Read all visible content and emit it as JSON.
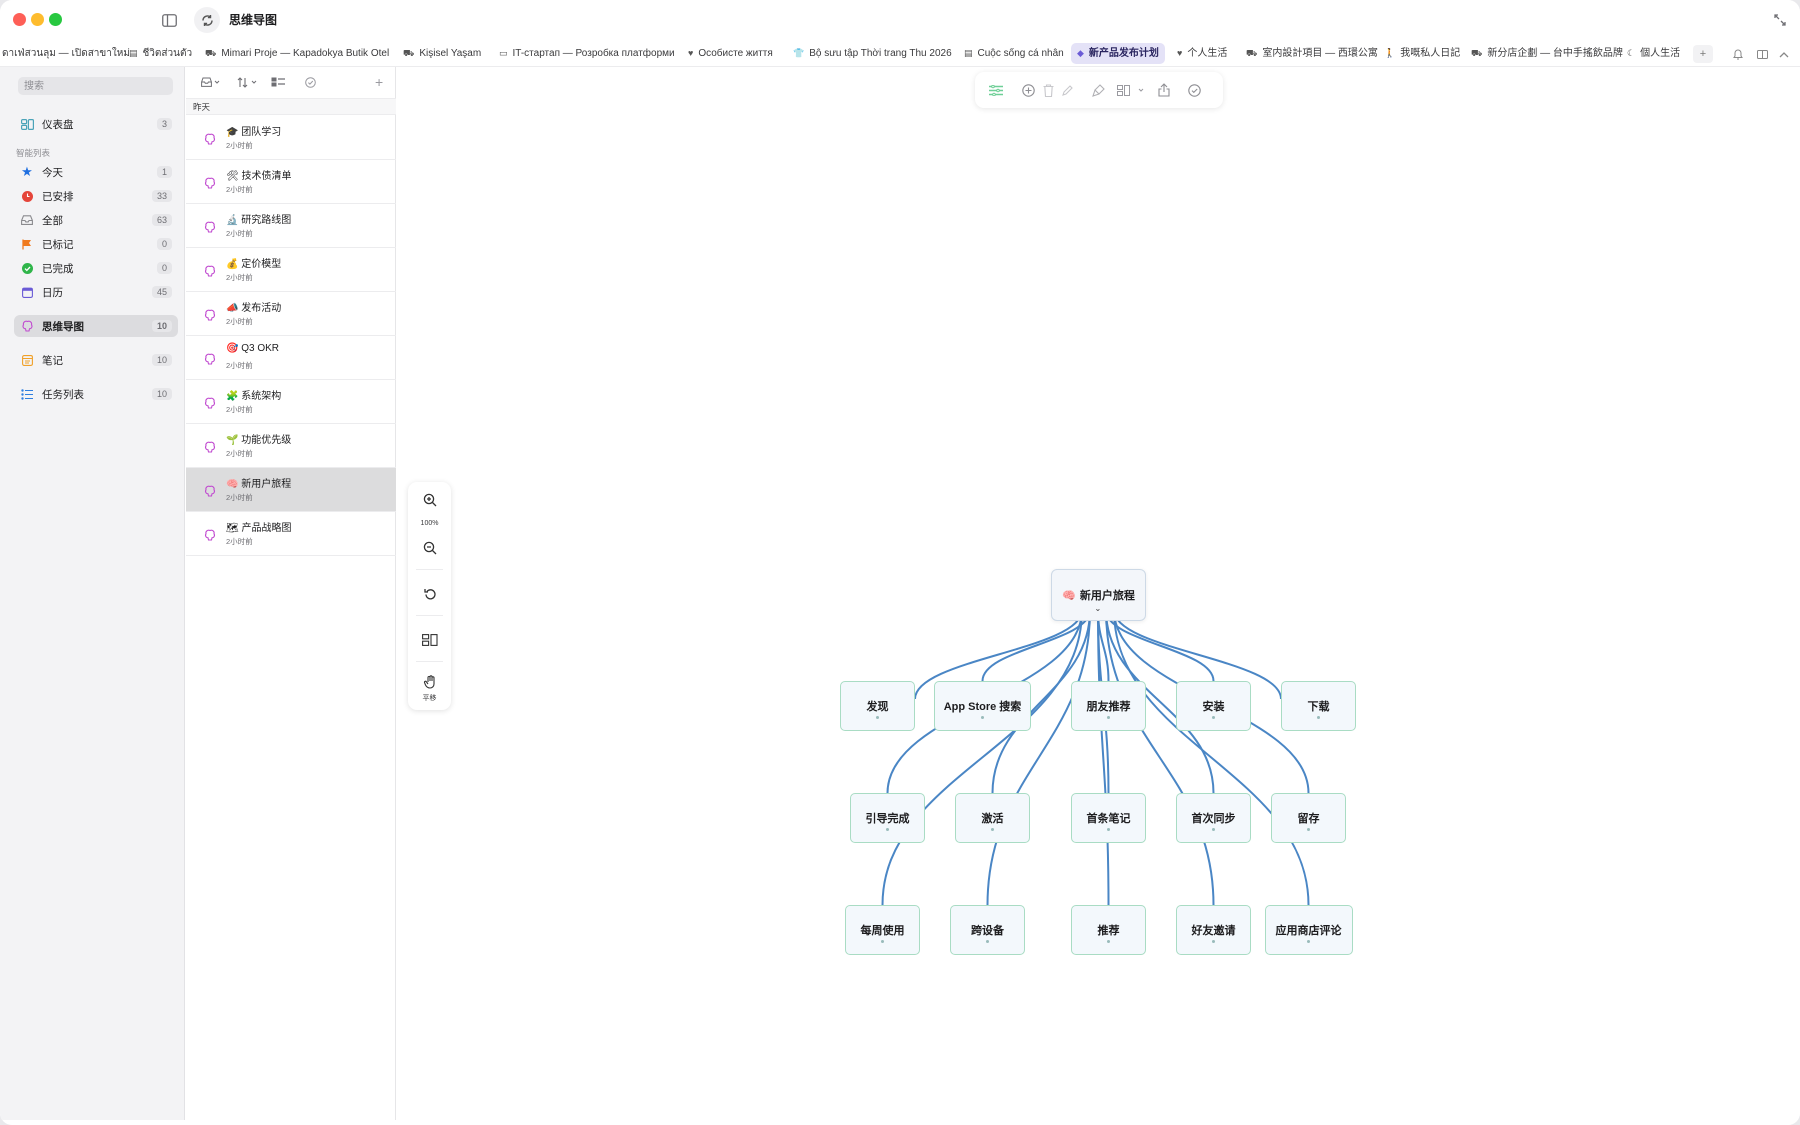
{
  "app": {
    "title": "思维导图"
  },
  "tabs": [
    {
      "label": "ดาเฟ่สวนลุม — เปิดสาขาใหม่",
      "icon": "none"
    },
    {
      "label": "ชีวิตส่วนตัว",
      "icon": "note-icon"
    },
    {
      "label": "Mimari Proje — Kapadokya Butik Otel",
      "icon": "car-icon"
    },
    {
      "label": "Kişisel Yaşam",
      "icon": "car-icon"
    },
    {
      "label": "IT-стартап — Розробка платформи",
      "icon": "laptop-icon"
    },
    {
      "label": "Особисте життя",
      "icon": "heart-icon"
    },
    {
      "label": "Bộ sưu tập Thời trang Thu 2026",
      "icon": "shirt-icon"
    },
    {
      "label": "Cuộc sống cá nhân",
      "icon": "note-icon"
    },
    {
      "label": "新产品发布计划",
      "icon": "cube-icon",
      "active": true
    },
    {
      "label": "个人生活",
      "icon": "heart-icon"
    },
    {
      "label": "室内設計項目 — 西環公寓",
      "icon": "sofa-icon"
    },
    {
      "label": "我嘅私人日記",
      "icon": "walk-icon"
    },
    {
      "label": "新分店企劃 — 台中手搖飲品牌",
      "icon": "car-icon"
    },
    {
      "label": "個人生活",
      "icon": "moon-icon"
    }
  ],
  "sidebar": {
    "search_placeholder": "搜索",
    "section_label": "智能列表",
    "items": [
      {
        "label": "仪表盘",
        "count": "3",
        "icon": "dashboard-icon",
        "color": "#4aa3b8"
      },
      {
        "label": "今天",
        "count": "1",
        "icon": "star-icon",
        "color": "#1f6fe0"
      },
      {
        "label": "已安排",
        "count": "33",
        "icon": "clock-icon",
        "color": "#e5453a"
      },
      {
        "label": "全部",
        "count": "63",
        "icon": "tray-icon",
        "color": "#8a8a8e"
      },
      {
        "label": "已标记",
        "count": "0",
        "icon": "flag-icon",
        "color": "#f07a1e"
      },
      {
        "label": "已完成",
        "count": "0",
        "icon": "check-circle-icon",
        "color": "#2fb54a"
      },
      {
        "label": "日历",
        "count": "45",
        "icon": "calendar-icon",
        "color": "#6a5ad6"
      },
      {
        "label": "思维导图",
        "count": "10",
        "icon": "brain-icon",
        "color": "#c14bd0"
      },
      {
        "label": "笔记",
        "count": "10",
        "icon": "notes-icon",
        "color": "#f0a028"
      },
      {
        "label": "任务列表",
        "count": "10",
        "icon": "checklist-icon",
        "color": "#2f7fe0"
      }
    ]
  },
  "list": {
    "group_label": "昨天",
    "items": [
      {
        "emoji": "🎓",
        "title": "团队学习",
        "time": "2小时前"
      },
      {
        "emoji": "🛠",
        "title": "技术债清单",
        "time": "2小时前"
      },
      {
        "emoji": "🔬",
        "title": "研究路线图",
        "time": "2小时前"
      },
      {
        "emoji": "💰",
        "title": "定价模型",
        "time": "2小时前"
      },
      {
        "emoji": "📣",
        "title": "发布活动",
        "time": "2小时前"
      },
      {
        "emoji": "🎯",
        "title": "Q3 OKR",
        "time": "2小时前"
      },
      {
        "emoji": "🧩",
        "title": "系统架构",
        "time": "2小时前"
      },
      {
        "emoji": "🌱",
        "title": "功能优先级",
        "time": "2小时前"
      },
      {
        "emoji": "🧠",
        "title": "新用户旅程",
        "time": "2小时前",
        "selected": true
      },
      {
        "emoji": "🗺",
        "title": "产品战略图",
        "time": "2小时前"
      }
    ]
  },
  "zoom": {
    "level": "100%",
    "pan_label": "平移"
  },
  "mindmap": {
    "root": {
      "emoji": "🧠",
      "label": "新用户旅程"
    },
    "nodes": [
      "发现",
      "App Store 搜索",
      "朋友推荐",
      "安装",
      "下载",
      "引导完成",
      "激活",
      "首条笔记",
      "首次同步",
      "留存",
      "每周使用",
      "跨设备",
      "推荐",
      "好友邀请",
      "应用商店评论"
    ]
  },
  "colors": {
    "accent": "#6b5bd6",
    "edge": "#4a86c5",
    "node_border": "#a9dcc4"
  }
}
